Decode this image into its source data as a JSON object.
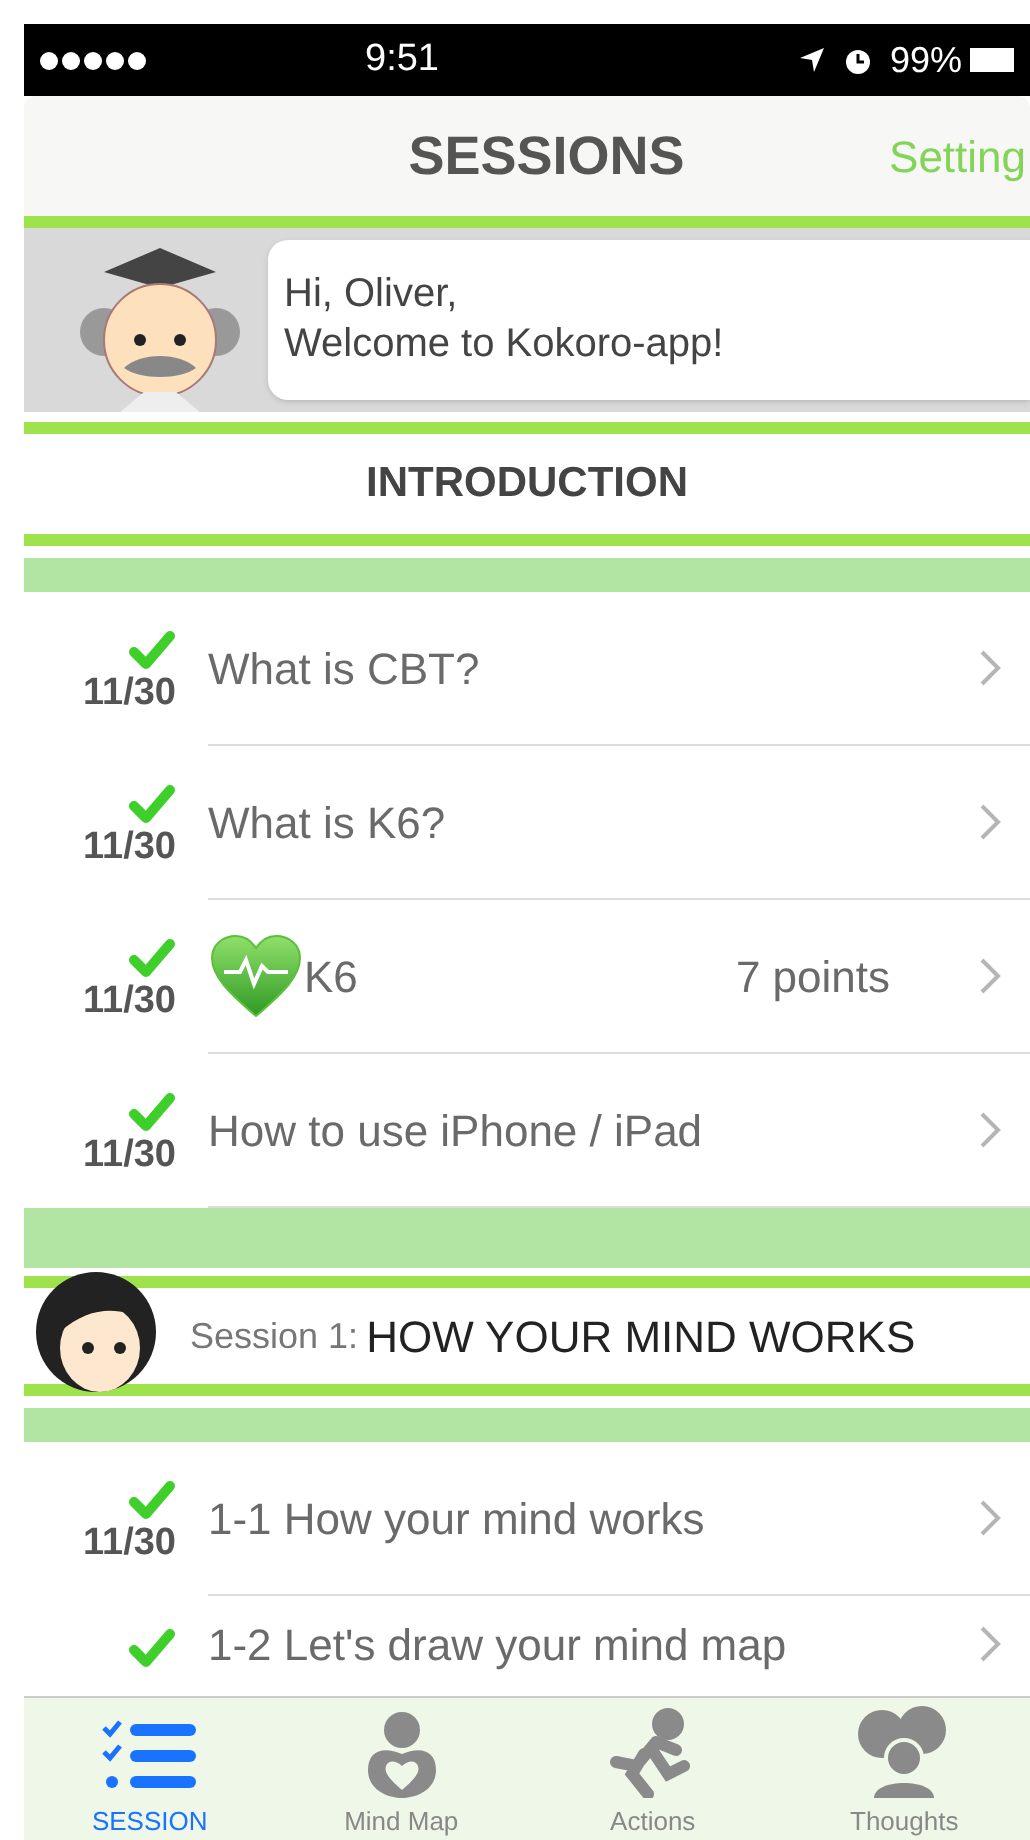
{
  "status_bar": {
    "time": "9:51",
    "battery": "99%"
  },
  "nav": {
    "title": "SESSIONS",
    "action": "Setting"
  },
  "banner": {
    "greeting": "Hi, Oliver,",
    "message": "Welcome to Kokoro-app!"
  },
  "sections": [
    {
      "kind": "intro",
      "title": "INTRODUCTION",
      "items": [
        {
          "kind": "text",
          "label": "What is CBT?",
          "done": true,
          "date": "11/30"
        },
        {
          "kind": "text",
          "label": "What is K6?",
          "done": true,
          "date": "11/30"
        },
        {
          "kind": "score",
          "label": "K6",
          "value": "7 points",
          "done": true,
          "date": "11/30"
        },
        {
          "kind": "text",
          "label": "How to use iPhone / iPad",
          "done": true,
          "date": "11/30"
        }
      ]
    },
    {
      "kind": "session",
      "prefix": "Session 1:",
      "title": "HOW YOUR MIND WORKS",
      "items": [
        {
          "kind": "text",
          "label": "1-1 How your mind works",
          "done": true,
          "date": "11/30"
        },
        {
          "kind": "text",
          "label": "1-2 Let's draw your mind map",
          "done": true
        }
      ]
    }
  ],
  "tab_bar": [
    {
      "kind": "session",
      "label": "SESSION",
      "selected": true
    },
    {
      "kind": "mindmap",
      "label": "Mind Map",
      "selected": false
    },
    {
      "kind": "actions",
      "label": "Actions",
      "selected": false
    },
    {
      "kind": "thoughts",
      "label": "Thoughts",
      "selected": false
    }
  ]
}
